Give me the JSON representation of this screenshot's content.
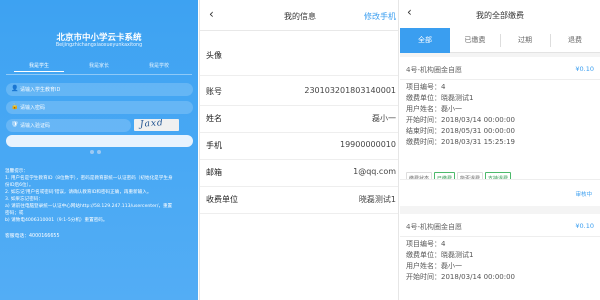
{
  "login": {
    "title": "北京市中小学云卡系统",
    "subtitle": "Beijingzhichangxiaoxueyunkaxitong",
    "tabs": [
      "我是学生",
      "我是家长",
      "我是学校"
    ],
    "student_id_placeholder": "请输入学生教育ID",
    "password_placeholder": "请输入密码",
    "captcha_placeholder": "请输入验证码",
    "captcha_text": "Jaxd",
    "notes": [
      "温馨提示：",
      "1. 用户名是学生教育ID（8位数字），密码是教育部统一认证密码（初始化是学生身",
      "份ID后6位）。",
      "2. 如忘记'用户名或密码'错误，请确认教育ID和密码正确，再重新输入。",
      "3. 如果忘记密码：",
      "a) 请前往电脑登录统一认证中心网站http://58.129.247.113/usercenter/，重置",
      "密码；或",
      "b) 请致电4006310001（9:1-5分机）重置密码。"
    ],
    "hotline": "客服电话：4000166655"
  },
  "myinfo": {
    "back_icon": "chevron-left-icon",
    "title": "我的信息",
    "action": "修改手机",
    "rows": [
      {
        "label": "头像",
        "value": ""
      },
      {
        "label": "账号",
        "value": "230103201803140001"
      },
      {
        "label": "姓名",
        "value": "磊小一"
      },
      {
        "label": "手机",
        "value": "19900000010"
      },
      {
        "label": "邮箱",
        "value": "1@qq.com"
      },
      {
        "label": "收费单位",
        "value": "晓磊测试1"
      }
    ]
  },
  "payments": {
    "back_icon": "chevron-left-icon",
    "title": "我的全部缴费",
    "tabs": [
      "全部",
      "已缴费",
      "过期",
      "退费"
    ],
    "active_tab": "全部",
    "accent_color": "#3a9ef0",
    "cards": [
      {
        "title": "4号-机构圈金自愿",
        "amount": "¥0.10",
        "details": [
          "项目编号：4",
          "缴费单位：晓磊测试1",
          "用户姓名：磊小一",
          "开始时间：2018/03/14 00:00:00",
          "结束时间：2018/05/31 00:00:00",
          "缴费时间：2018/03/31 15:25:19"
        ],
        "tags": [
          "缴费状态",
          "已缴费",
          "能否退费",
          "支持退费"
        ],
        "audit": "审核中"
      },
      {
        "title": "4号-机构圈金自愿",
        "amount": "¥0.10",
        "details": [
          "项目编号：4",
          "缴费单位：晓磊测试1",
          "用户姓名：磊小一",
          "开始时间：2018/03/14 00:00:00"
        ]
      }
    ]
  }
}
